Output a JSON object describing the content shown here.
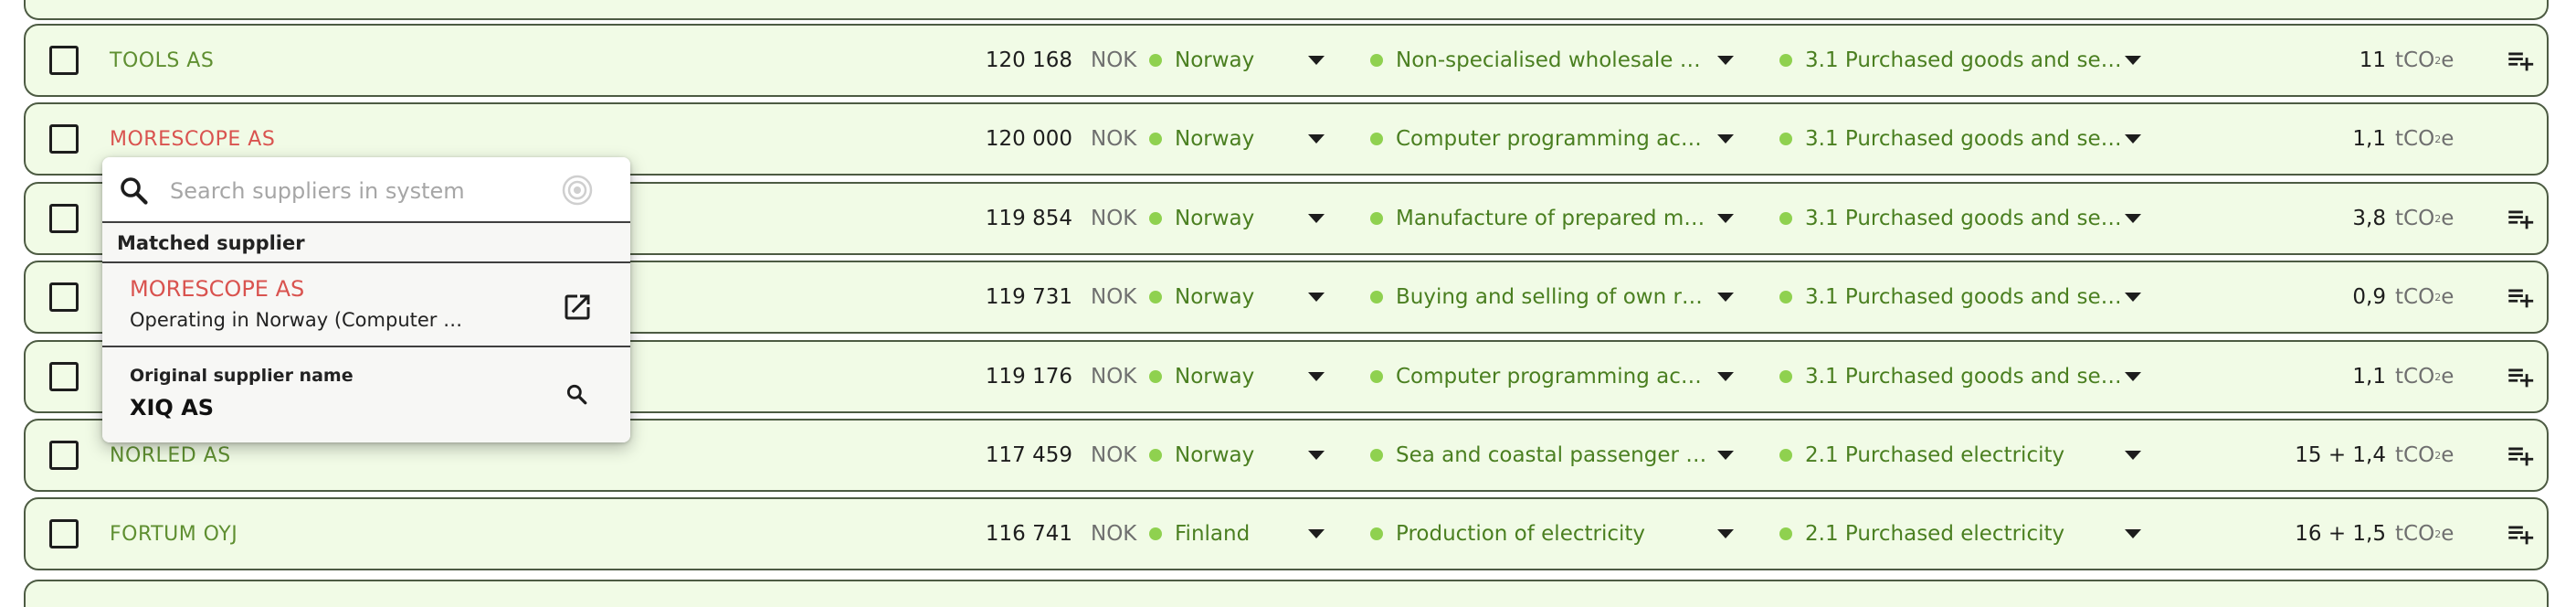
{
  "rows": [
    {
      "name": "TOOLS AS",
      "amount": "120 168",
      "currency": "NOK",
      "country": "Norway",
      "industry": "Non-specialised wholesale …",
      "category": "3.1 Purchased goods and se…",
      "emission": "11",
      "unit": "tCO₂e",
      "unit_main": "tCO",
      "unit_sub": "2",
      "unit_end": "e"
    },
    {
      "name": "MORESCOPE AS",
      "amount": "120 000",
      "currency": "NOK",
      "country": "Norway",
      "industry": "Computer programming ac…",
      "category": "3.1 Purchased goods and se…",
      "emission": "1,1",
      "unit": "tCO₂e",
      "unit_main": "tCO",
      "unit_sub": "2",
      "unit_end": "e"
    },
    {
      "name": "",
      "amount": "119 854",
      "currency": "NOK",
      "country": "Norway",
      "industry": "Manufacture of prepared m…",
      "category": "3.1 Purchased goods and se…",
      "emission": "3,8",
      "unit": "tCO₂e",
      "unit_main": "tCO",
      "unit_sub": "2",
      "unit_end": "e"
    },
    {
      "name": "",
      "amount": "119 731",
      "currency": "NOK",
      "country": "Norway",
      "industry": "Buying and selling of own r…",
      "category": "3.1 Purchased goods and se…",
      "emission": "0,9",
      "unit": "tCO₂e",
      "unit_main": "tCO",
      "unit_sub": "2",
      "unit_end": "e"
    },
    {
      "name": "",
      "amount": "119 176",
      "currency": "NOK",
      "country": "Norway",
      "industry": "Computer programming ac…",
      "category": "3.1 Purchased goods and se…",
      "emission": "1,1",
      "unit": "tCO₂e",
      "unit_main": "tCO",
      "unit_sub": "2",
      "unit_end": "e"
    },
    {
      "name": "NORLED AS",
      "amount": "117 459",
      "currency": "NOK",
      "country": "Norway",
      "industry": "Sea and coastal passenger …",
      "category": "2.1 Purchased electricity",
      "emission": "15 + 1,4",
      "unit": "tCO₂e",
      "unit_main": "tCO",
      "unit_sub": "2",
      "unit_end": "e"
    },
    {
      "name": "FORTUM OYJ",
      "amount": "116 741",
      "currency": "NOK",
      "country": "Finland",
      "industry": "Production of electricity",
      "category": "2.1 Purchased electricity",
      "emission": "16 + 1,5",
      "unit": "tCO₂e",
      "unit_main": "tCO",
      "unit_sub": "2",
      "unit_end": "e"
    }
  ],
  "popup": {
    "search_placeholder": "Search suppliers in system",
    "section_title": "Matched supplier",
    "matched_name": "MORESCOPE AS",
    "matched_desc": "Operating in Norway (Computer …",
    "original_label": "Original supplier name",
    "original_value": "XIQ AS"
  },
  "colors": {
    "row_bg": "#f1fbe6",
    "row_border": "#4d5b43",
    "accent_green": "#8fd14f",
    "text_green": "#4a7f20",
    "name_green": "#5f8f31",
    "name_red": "#d9534f"
  },
  "icons": {
    "add_to_list": "playlist-add-icon",
    "search": "search-icon",
    "target": "target-icon",
    "open_external": "open-in-new-icon",
    "dropdown": "caret-down-icon"
  }
}
